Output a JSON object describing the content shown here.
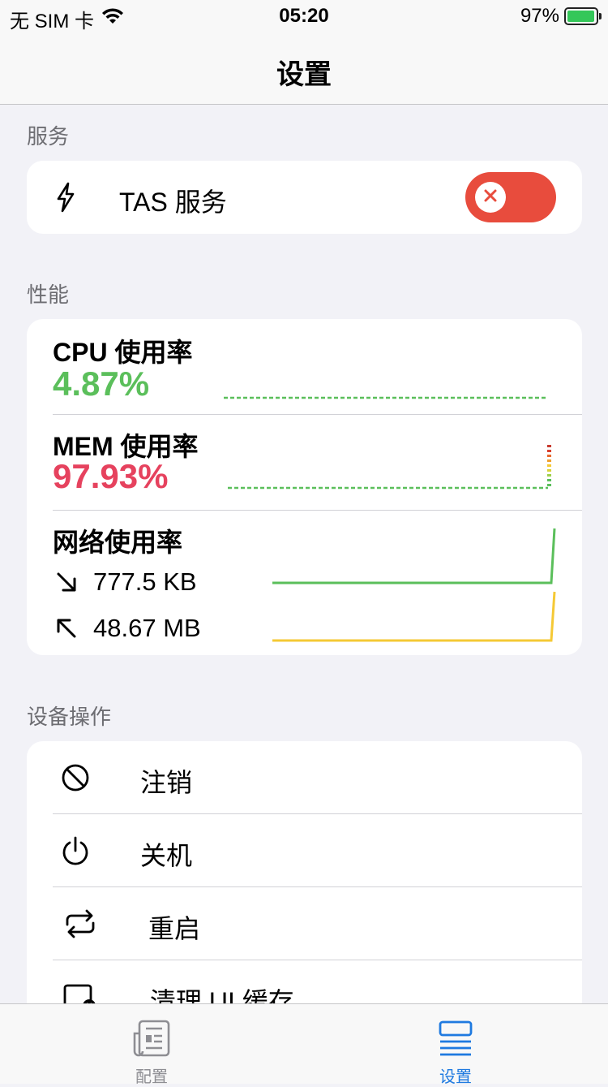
{
  "status_bar": {
    "carrier": "无 SIM 卡",
    "time": "05:20",
    "battery_percent_label": "97%",
    "battery_level": 0.97
  },
  "nav": {
    "title": "设置"
  },
  "sections": {
    "service": "服务",
    "performance": "性能",
    "device_ops": "设备操作"
  },
  "tas": {
    "label": "TAS 服务",
    "icon": "bolt-icon",
    "toggle_on": false,
    "toggle_color": "#e84c3d"
  },
  "performance": {
    "cpu": {
      "title": "CPU 使用率",
      "value": "4.87%",
      "color": "#5bbf5b"
    },
    "mem": {
      "title": "MEM 使用率",
      "value": "97.93%",
      "color": "#e6425e"
    },
    "network": {
      "title": "网络使用率",
      "download": "777.5 KB",
      "upload": "48.67 MB",
      "download_color": "#5bbf5b",
      "upload_color": "#f5c935"
    }
  },
  "device_ops": [
    {
      "label": "注销",
      "icon": "prohibit-icon"
    },
    {
      "label": "关机",
      "icon": "power-icon"
    },
    {
      "label": "重启",
      "icon": "repeat-icon"
    },
    {
      "label": "清理 UI 缓存",
      "icon": "clear-cache-icon"
    }
  ],
  "tab_bar": {
    "tabs": [
      {
        "label": "配置",
        "icon": "newspaper-icon",
        "active": false
      },
      {
        "label": "设置",
        "icon": "list-icon",
        "active": true
      }
    ],
    "active_color": "#1f7ae0",
    "inactive_color": "#8e8e93"
  }
}
